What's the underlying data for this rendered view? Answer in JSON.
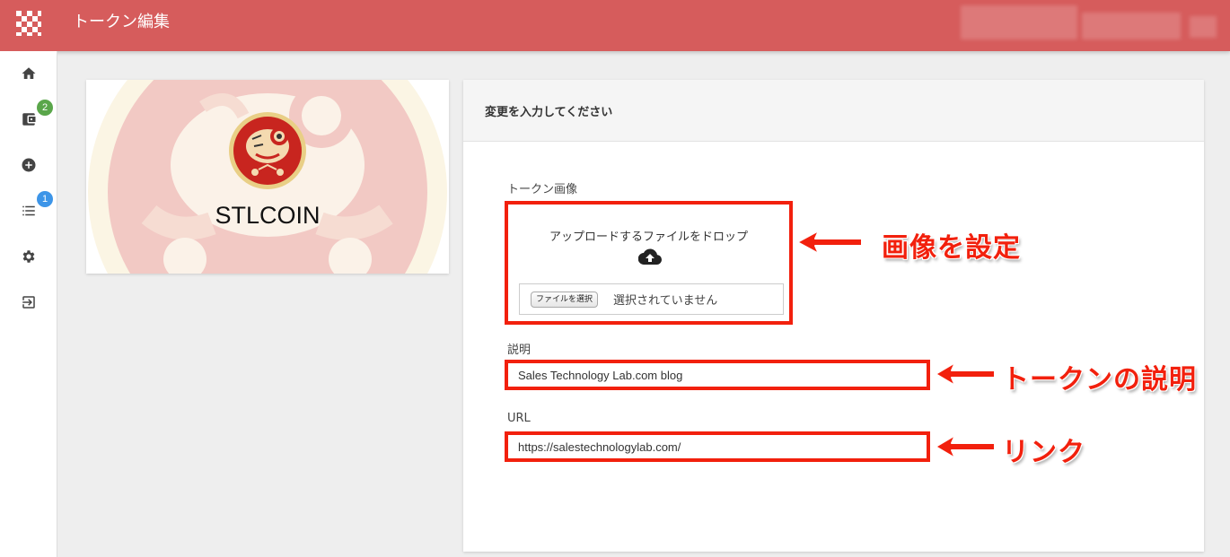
{
  "header": {
    "title": "トークン編集",
    "logo_icon": "checker-logo-icon",
    "background": "#d65c5c"
  },
  "sidebar": {
    "items": [
      {
        "name": "home",
        "icon": "home-icon"
      },
      {
        "name": "wallet",
        "icon": "wallet-icon",
        "badge": "2",
        "badge_color": "#5aa64a"
      },
      {
        "name": "create",
        "icon": "add-circle-icon"
      },
      {
        "name": "list",
        "icon": "list-icon",
        "badge": "1",
        "badge_color": "#3d95e8"
      },
      {
        "name": "settings",
        "icon": "gear-icon"
      },
      {
        "name": "logout",
        "icon": "exit-icon"
      }
    ]
  },
  "token_preview": {
    "name": "STLCOIN"
  },
  "form": {
    "header": "変更を入力してください",
    "image_label": "トークン画像",
    "drop_text": "アップロードするファイルをドロップ",
    "upload_icon": "cloud-upload-icon",
    "file_button": "ファイルを選択",
    "file_status": "選択されていません",
    "description_label": "説明",
    "description_value": "Sales Technology Lab.com blog",
    "url_label": "URL",
    "url_value": "https://salestechnologylab.com/"
  },
  "annotations": {
    "color": "#f2200d",
    "image_callout": "画像を設定",
    "description_callout": "トークンの説明",
    "link_callout": "リンク"
  }
}
